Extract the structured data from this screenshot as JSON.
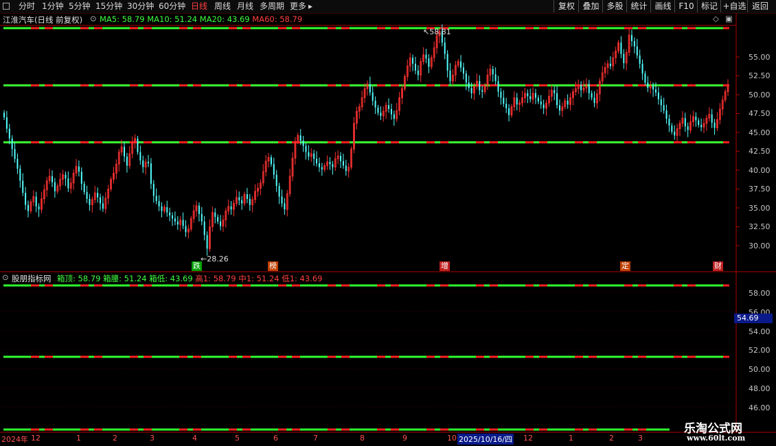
{
  "toolbar": {
    "periods": [
      "分时",
      "1分钟",
      "5分钟",
      "15分钟",
      "30分钟",
      "60分钟",
      "日线",
      "周线",
      "月线",
      "多周期",
      "更多"
    ],
    "active_period": "日线",
    "right_buttons": [
      "复权",
      "叠加",
      "多股",
      "统计",
      "画线",
      "F10",
      "标记",
      "+自选",
      "返回"
    ]
  },
  "main_panel": {
    "stock_title": "江淮汽车(日线 前复权)",
    "ma": [
      {
        "label": "MA5: 58.79",
        "color": "#40ff40"
      },
      {
        "label": "MA10: 51.24",
        "color": "#40ff40"
      },
      {
        "label": "MA20: 43.69",
        "color": "#40ff40"
      },
      {
        "label": "MA60: 58.79",
        "color": "#ff4040"
      }
    ],
    "high_marker": "58.81",
    "low_marker": "28.26",
    "badges": [
      {
        "text": "跌",
        "bg": "#00a000"
      },
      {
        "text": "榜",
        "bg": "#c04000"
      },
      {
        "text": "增",
        "bg": "#c02020"
      },
      {
        "text": "定",
        "bg": "#c04000"
      },
      {
        "text": "财",
        "bg": "#c02020"
      }
    ]
  },
  "indicator_panel": {
    "name": "股朋指标网",
    "values": [
      {
        "label": "箱顶: 58.79",
        "color": "#40ff40"
      },
      {
        "label": "箱腰: 51.24",
        "color": "#40ff40"
      },
      {
        "label": "箱低: 43.69",
        "color": "#40ff40"
      },
      {
        "label": "高1: 58.79",
        "color": "#ff4040"
      },
      {
        "label": "中1: 51.24",
        "color": "#ff4040"
      },
      {
        "label": "低1: 43.69",
        "color": "#ff4040"
      }
    ],
    "cursor_value": "54.69"
  },
  "axis": {
    "main_ticks": [
      "55.00",
      "52.50",
      "50.00",
      "47.50",
      "45.00",
      "42.50",
      "40.00",
      "37.50",
      "35.00",
      "32.50",
      "30.00"
    ],
    "ind_ticks": [
      "58.00",
      "56.00",
      "54.00",
      "52.00",
      "50.00",
      "48.00",
      "46.00"
    ],
    "x_labels": [
      "2024年",
      "12",
      "1",
      "2",
      "3",
      "4",
      "5",
      "6",
      "7",
      "8",
      "9",
      "10",
      "12",
      "1",
      "2",
      "3"
    ],
    "x_highlight": "2025/10/16/四"
  },
  "watermark": {
    "title": "乐淘公式网",
    "url": "www.60lt.com"
  },
  "colors": {
    "up": "#ff3232",
    "down": "#54ffff",
    "box_red": "#ff2020",
    "box_green": "#30ff30",
    "axis": "#b00000"
  },
  "chart_data": {
    "type": "candlestick",
    "ylim": [
      27,
      60
    ],
    "box_levels": {
      "top": 58.79,
      "mid": 51.24,
      "low": 43.69
    },
    "closes": [
      47.0,
      45.5,
      44.2,
      42.8,
      41.5,
      40.2,
      38.6,
      37.0,
      35.4,
      34.6,
      35.8,
      36.5,
      35.2,
      34.8,
      36.2,
      37.4,
      38.6,
      39.2,
      38.4,
      37.2,
      37.9,
      38.8,
      39.4,
      38.9,
      37.6,
      38.3,
      39.6,
      40.5,
      39.8,
      38.2,
      37.1,
      36.2,
      35.4,
      36.1,
      37.0,
      36.4,
      35.6,
      34.9,
      36.3,
      37.5,
      38.8,
      39.6,
      40.8,
      42.4,
      43.1,
      41.8,
      40.6,
      42.2,
      43.7,
      44.2,
      42.4,
      41.3,
      40.4,
      41.1,
      40.9,
      38.2,
      36.6,
      35.9,
      35.2,
      34.6,
      35.1,
      34.4,
      34.0,
      33.6,
      33.2,
      32.8,
      33.4,
      32.6,
      31.8,
      32.2,
      33.6,
      34.6,
      35.3,
      34.2,
      33.2,
      31.4,
      29.6,
      32.5,
      34.4,
      33.8,
      33.2,
      32.6,
      33.4,
      34.6,
      35.2,
      34.8,
      35.6,
      36.4,
      36.0,
      35.6,
      36.8,
      36.2,
      35.4,
      36.1,
      37.2,
      37.6,
      38.3,
      39.8,
      41.2,
      41.7,
      40.8,
      39.4,
      37.9,
      36.5,
      35.6,
      34.8,
      36.9,
      39.2,
      41.6,
      43.8,
      44.6,
      43.9,
      43.2,
      42.4,
      41.8,
      42.2,
      41.5,
      40.9,
      40.4,
      40.1,
      40.6,
      41.1,
      40.8,
      40.4,
      41.5,
      41.9,
      41.2,
      40.6,
      39.9,
      40.4,
      42.8,
      46.2,
      47.8,
      48.4,
      49.6,
      50.8,
      51.4,
      50.3,
      49.2,
      48.3,
      47.6,
      47.2,
      47.8,
      48.6,
      48.1,
      47.4,
      46.8,
      47.9,
      49.6,
      50.8,
      52.4,
      53.8,
      54.9,
      54.1,
      53.2,
      52.6,
      54.4,
      55.3,
      54.8,
      53.7,
      54.9,
      56.2,
      57.8,
      58.4,
      56.9,
      55.4,
      53.2,
      51.8,
      52.6,
      53.9,
      54.4,
      53.6,
      52.8,
      51.6,
      50.9,
      50.2,
      51.1,
      51.8,
      50.6,
      50.4,
      51.2,
      52.6,
      53.4,
      52.7,
      51.8,
      50.4,
      49.6,
      48.8,
      48.2,
      47.3,
      48.4,
      49.6,
      48.7,
      48.9,
      49.6,
      50.2,
      49.8,
      49.4,
      50.2,
      49.6,
      49.1,
      48.7,
      48.2,
      48.9,
      49.8,
      50.6,
      50.2,
      48.6,
      47.9,
      48.4,
      49.2,
      48.7,
      49.6,
      50.4,
      50.8,
      51.3,
      50.6,
      50.9,
      51.4,
      50.2,
      49.6,
      48.9,
      50.1,
      51.8,
      52.9,
      53.6,
      54.1,
      53.8,
      54.9,
      55.8,
      56.9,
      55.4,
      54.2,
      55.6,
      57.9,
      57.1,
      56.4,
      55.2,
      54.1,
      52.8,
      51.6,
      50.9,
      51.2,
      50.7,
      50.3,
      49.4,
      48.6,
      47.9,
      46.8,
      45.9,
      45.1,
      44.6,
      45.5,
      46.2,
      46.9,
      45.8,
      45.3,
      46.4,
      47.1,
      46.6,
      46.0,
      45.7,
      46.2,
      46.9,
      47.4,
      46.3,
      45.6,
      46.7,
      48.1,
      49.3,
      50.4,
      51.2
    ]
  }
}
